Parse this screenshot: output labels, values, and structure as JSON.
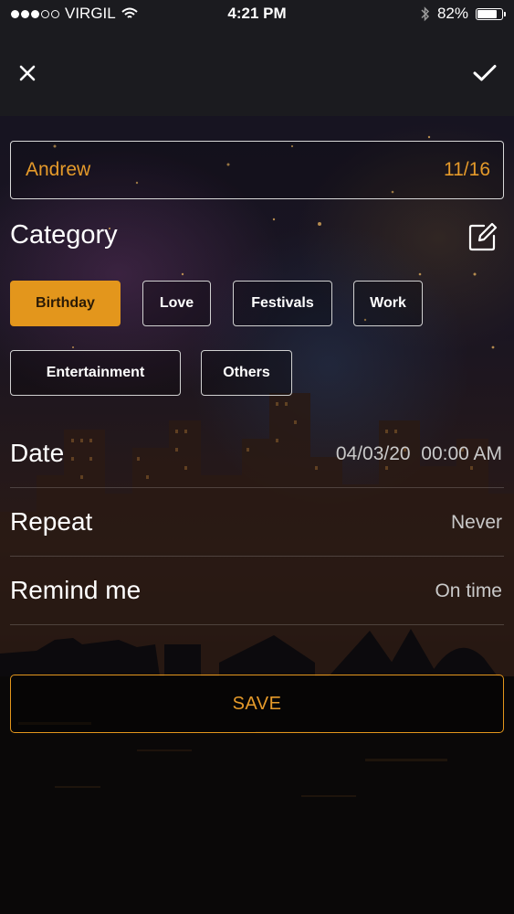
{
  "status_bar": {
    "carrier": "VIRGIL",
    "time": "4:21 PM",
    "battery": "82%",
    "battery_level": 0.82,
    "signal_bars_filled": 3,
    "signal_bars_total": 5,
    "icons": [
      "wifi-icon",
      "bluetooth-icon",
      "battery-icon"
    ]
  },
  "nav": {
    "close_icon": "close-icon",
    "confirm_icon": "checkmark-icon"
  },
  "name_field": {
    "value": "Andrew",
    "counter": "11/16"
  },
  "category": {
    "title": "Category",
    "edit_icon": "edit-icon",
    "selected": "Birthday",
    "chips": [
      "Birthday",
      "Love",
      "Festivals",
      "Work",
      "Entertainment",
      "Others"
    ]
  },
  "date_row": {
    "label": "Date",
    "value": "04/03/20  00:00 AM"
  },
  "repeat_row": {
    "label": "Repeat",
    "value": "Never"
  },
  "remind_row": {
    "label": "Remind me",
    "value": "On time"
  },
  "save_button": {
    "label": "SAVE"
  },
  "colors": {
    "accent": "#e3961c",
    "bar_background": "#1b1b1f",
    "text": "#ffffff",
    "muted_text": "#c9c9c9"
  }
}
